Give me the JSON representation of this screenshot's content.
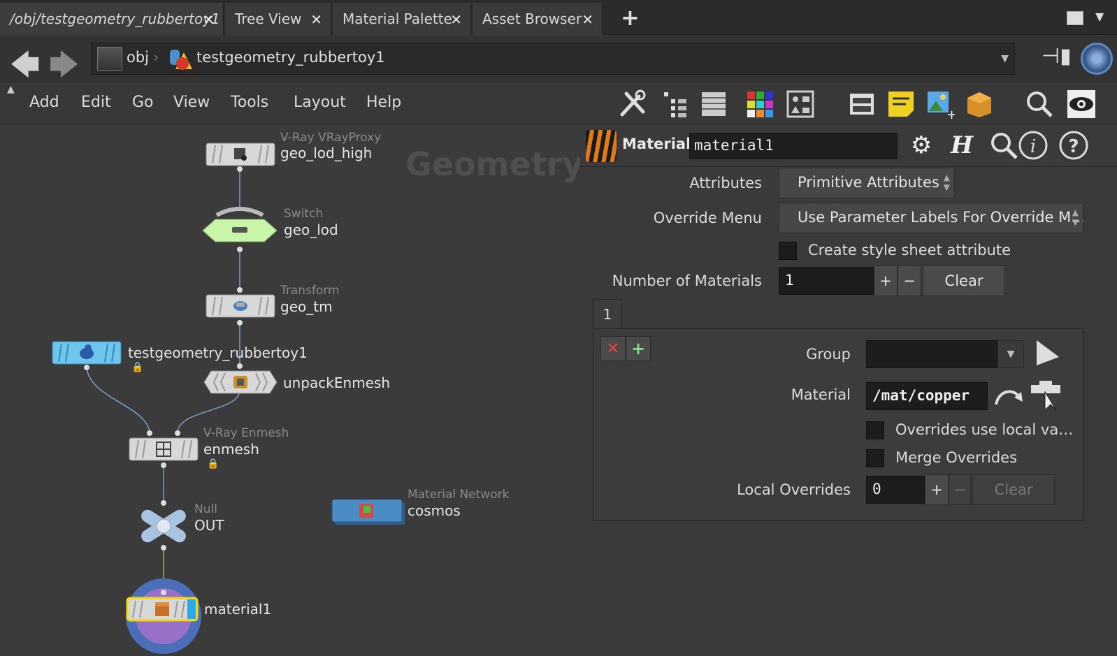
{
  "tabs": [
    {
      "label": "/obj/testgeometry_rubbertoy1",
      "active": true
    },
    {
      "label": "Tree View"
    },
    {
      "label": "Material Palette"
    },
    {
      "label": "Asset Browser"
    }
  ],
  "path": {
    "root": "obj",
    "current": "testgeometry_rubbertoy1"
  },
  "menu": [
    "Add",
    "Edit",
    "Go",
    "View",
    "Tools",
    "Layout",
    "Help"
  ],
  "network": {
    "context_label": "Geometry",
    "nodes": {
      "geo_lod_high": {
        "type": "V-Ray VRayProxy",
        "name": "geo_lod_high"
      },
      "geo_lod": {
        "type": "Switch",
        "name": "geo_lod"
      },
      "geo_tm": {
        "type": "Transform",
        "name": "geo_tm"
      },
      "rubbertoy": {
        "name": "testgeometry_rubbertoy1"
      },
      "unpack": {
        "name": "unpackEnmesh"
      },
      "enmesh": {
        "type": "V-Ray Enmesh",
        "name": "enmesh"
      },
      "out": {
        "type": "Null",
        "name": "OUT"
      },
      "cosmos": {
        "type": "Material Network",
        "name": "cosmos"
      },
      "material1": {
        "name": "material1"
      }
    }
  },
  "params": {
    "node_type": "Material",
    "node_name": "material1",
    "attributes_label": "Attributes",
    "attributes_value": "Primitive Attributes",
    "override_menu_label": "Override Menu",
    "override_menu_value": "Use Parameter Labels For Override M…",
    "style_sheet_label": "Create style sheet attribute",
    "num_materials_label": "Number of Materials",
    "num_materials_value": "1",
    "clear_label": "Clear",
    "multi_tab": "1",
    "group_label": "Group",
    "group_value": "",
    "material_label": "Material",
    "material_value": "/mat/copper",
    "overrides_local_label": "Overrides use local va…",
    "merge_overrides_label": "Merge Overrides",
    "local_overrides_label": "Local Overrides",
    "local_overrides_value": "0",
    "clear2_label": "Clear"
  },
  "colors": {
    "switch_node": "#c8f5a8",
    "rubbertoy_node": "#6cc6ee",
    "cosmos_node": "#4a8cc4",
    "selected_outline": "#f5d800",
    "material_ring": "#4a6fb8",
    "material_inner": "#9870c8"
  }
}
